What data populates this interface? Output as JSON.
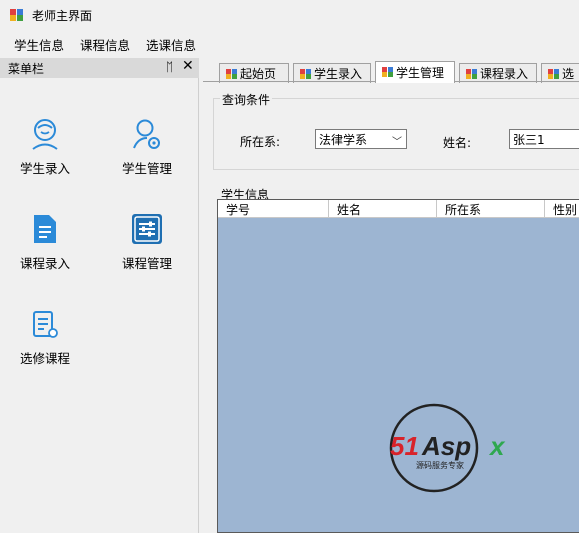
{
  "window": {
    "title": "老师主界面"
  },
  "menu": [
    "学生信息",
    "课程信息",
    "选课信息"
  ],
  "sidebar": {
    "title": "菜单栏",
    "pin_glyph": "ᛖ",
    "close_glyph": "✕",
    "items": [
      {
        "label": "学生录入",
        "icon": "student-entry-icon"
      },
      {
        "label": "学生管理",
        "icon": "student-manage-icon"
      },
      {
        "label": "课程录入",
        "icon": "course-entry-icon"
      },
      {
        "label": "课程管理",
        "icon": "course-manage-icon"
      },
      {
        "label": "选修课程",
        "icon": "elective-course-icon"
      }
    ]
  },
  "tabs": [
    {
      "label": "起始页"
    },
    {
      "label": "学生录入"
    },
    {
      "label": "学生管理",
      "active": true
    },
    {
      "label": "课程录入"
    },
    {
      "label": "选"
    }
  ],
  "query": {
    "group_title": "查询条件",
    "dept_label": "所在系:",
    "dept_value": "法律学系",
    "name_label": "姓名:",
    "name_value": "张三1"
  },
  "grid": {
    "title": "学生信息",
    "columns": [
      "学号",
      "姓名",
      "所在系",
      "性别"
    ],
    "background": "#9db5d2"
  },
  "watermark": {
    "brand_red": "51",
    "brand_dark": "Asp",
    "brand_green": "x",
    "tagline": "源码服务专家"
  },
  "colors": {
    "icon_blue": "#2b8ad8",
    "brand_red": "#d8232a",
    "brand_green": "#2fa84f"
  }
}
